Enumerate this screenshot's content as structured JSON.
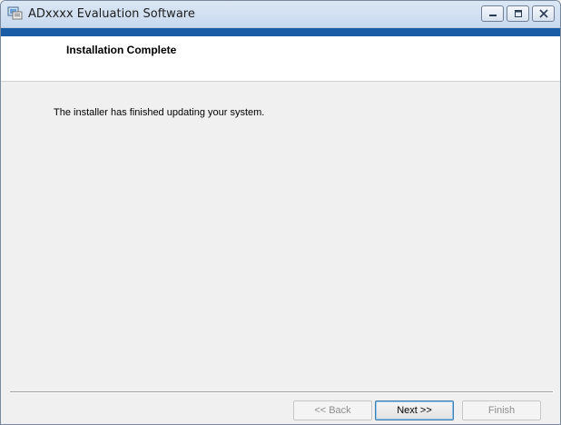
{
  "window": {
    "title": "ADxxxx Evaluation  Software",
    "accent_color": "#1a5da6",
    "icon": "installer-app-icon"
  },
  "caption_buttons": {
    "minimize_icon": "minimize-icon",
    "maximize_icon": "maximize-icon",
    "close_icon": "close-icon"
  },
  "banner": {
    "title": "Installation Complete"
  },
  "content": {
    "message": "The installer has finished updating your system."
  },
  "buttons": {
    "back": {
      "label": "<< Back",
      "enabled": false
    },
    "next": {
      "label": "Next >>",
      "enabled": true
    },
    "finish": {
      "label": "Finish",
      "enabled": false
    }
  }
}
